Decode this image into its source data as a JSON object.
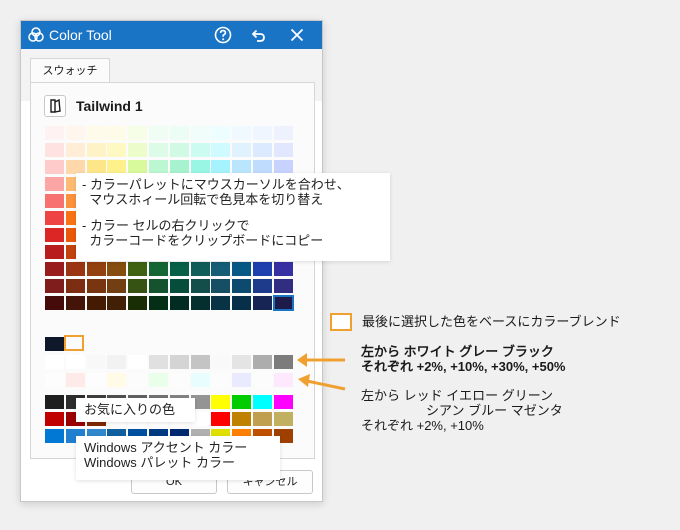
{
  "window": {
    "title": "Color Tool",
    "tab_label": "スウォッチ",
    "palette_name": "Tailwind 1",
    "ok_label": "OK",
    "cancel_label": "キャンセル",
    "accent": "#1a74c6"
  },
  "palette_grid": [
    [
      "#fef2f2",
      "#fff7ed",
      "#fffbeb",
      "#fefce8",
      "#f7fee7",
      "#f0fdf4",
      "#ecfdf5",
      "#f0fdfa",
      "#ecfeff",
      "#f0f9ff",
      "#eff6ff",
      "#eef2ff"
    ],
    [
      "#fee2e2",
      "#ffedd5",
      "#fef3c7",
      "#fef9c3",
      "#ecfccb",
      "#dcfce7",
      "#d1fae5",
      "#ccfbf1",
      "#cffafe",
      "#e0f2fe",
      "#dbeafe",
      "#e0e7ff"
    ],
    [
      "#fecaca",
      "#fed7aa",
      "#fde68a",
      "#fef08a",
      "#d9f99d",
      "#bbf7d0",
      "#a7f3d0",
      "#99f6e4",
      "#a5f3fc",
      "#bae6fd",
      "#bfdbfe",
      "#c7d2fe"
    ],
    [
      "#fca5a5",
      "#fdba74",
      "#fcd34d",
      "#fde047",
      "#bef264",
      "#86efac",
      "#6ee7b7",
      "#5eead4",
      "#67e8f9",
      "#7dd3fc",
      "#93c5fd",
      "#a5b4fc"
    ],
    [
      "#f87171",
      "#fb923c",
      "#fbbf24",
      "#facc15",
      "#a3e635",
      "#4ade80",
      "#34d399",
      "#2dd4bf",
      "#22d3ee",
      "#38bdf8",
      "#60a5fa",
      "#818cf8"
    ],
    [
      "#ef4444",
      "#f97316",
      "#f59e0b",
      "#eab308",
      "#84cc16",
      "#22c55e",
      "#10b981",
      "#14b8a6",
      "#06b6d4",
      "#0ea5e9",
      "#3b82f6",
      "#6366f1"
    ],
    [
      "#dc2626",
      "#ea580c",
      "#d97706",
      "#ca8a04",
      "#65a30d",
      "#16a34a",
      "#059669",
      "#0d9488",
      "#0891b2",
      "#0284c7",
      "#2563eb",
      "#4f46e5"
    ],
    [
      "#b91c1c",
      "#c2410c",
      "#b45309",
      "#a16207",
      "#4d7c0f",
      "#15803d",
      "#047857",
      "#0f766e",
      "#0e7490",
      "#0369a1",
      "#1d4ed8",
      "#4338ca"
    ],
    [
      "#991b1b",
      "#9a3412",
      "#92400e",
      "#854d0e",
      "#3f6212",
      "#166534",
      "#065f46",
      "#115e59",
      "#155e75",
      "#075985",
      "#1e40af",
      "#3730a3"
    ],
    [
      "#7f1d1d",
      "#7c2d12",
      "#78350f",
      "#713f12",
      "#365314",
      "#14532d",
      "#064e3b",
      "#134e4a",
      "#164e63",
      "#0c4a6e",
      "#1e3a8a",
      "#312e81"
    ],
    [
      "#450a0a",
      "#431407",
      "#451a03",
      "#422006",
      "#1a2e05",
      "#052e16",
      "#022c22",
      "#042f2e",
      "#083344",
      "#082f49",
      "#172554",
      "#1e1b4b"
    ]
  ],
  "blend": {
    "last_color": "#0f172a",
    "gray_row": [
      "#ffffff",
      "#ffffff",
      "#f8f8f8",
      "#f2f2f2",
      "#ffffff",
      "#e0e0e0",
      "#d4d4d4",
      "#c4c4c4",
      "#f9f9f9",
      "#e4e4e4",
      "#adadad",
      "#7c7c7c"
    ],
    "tint_row": [
      "#fdfdfd",
      "#ffeaea",
      "#fdfdfd",
      "#fffbe6",
      "#fcfcfc",
      "#eaffea",
      "#fcfcfc",
      "#e8fdfd",
      "#fcfcfc",
      "#eaeaff",
      "#fcfcfc",
      "#fde8fd"
    ]
  },
  "favorites": [
    [
      "#1e1e1e",
      "#2d2d2d",
      "#3e3e3e",
      "#4f4f4f",
      "#616161",
      "#727272",
      "#838383",
      "#949494",
      "#ffff00",
      "#00cc00",
      "#00ffff",
      "#ff00ff"
    ],
    [
      "#c00000",
      "#9a0000",
      "#7f2a00",
      "#ffffff",
      "#ffffff",
      "#ffffff",
      "#ffffff",
      "#ffffff",
      "#ff0000",
      "#c08000",
      "#c0a050",
      "#c0b060"
    ],
    [
      "#0078d4",
      "#2080d0",
      "#3088cc",
      "#1060a0",
      "#0050a0",
      "#003a80",
      "#002a70",
      "#b0b0b0",
      "#e0e000",
      "#ff8000",
      "#c05000",
      "#a04000"
    ]
  ],
  "tooltips": {
    "hint_lines": [
      "- カラーパレットにマウスカーソルを合わせ、",
      "  マウスホィール回転で色見本を切り替え",
      "",
      "- カラー セルの右クリックで",
      "  カラーコードをクリップボードにコピー"
    ],
    "favorites_label": "お気に入りの色",
    "windows_colors": "Windows アクセント カラー\nWindows パレット カラー"
  },
  "annotations": {
    "base_color_note": "最後に選択した色をベースにカラーブレンド",
    "gray_note": "左から ホワイト グレー ブラック\nそれぞれ +2%, +10%, +30%, +50%",
    "tint_note": "左から レッド イエロー グリーン\n　　　　　シアン ブルー マゼンタ\nそれぞれ +2%, +10%",
    "accent_orange": "#f0a030"
  }
}
